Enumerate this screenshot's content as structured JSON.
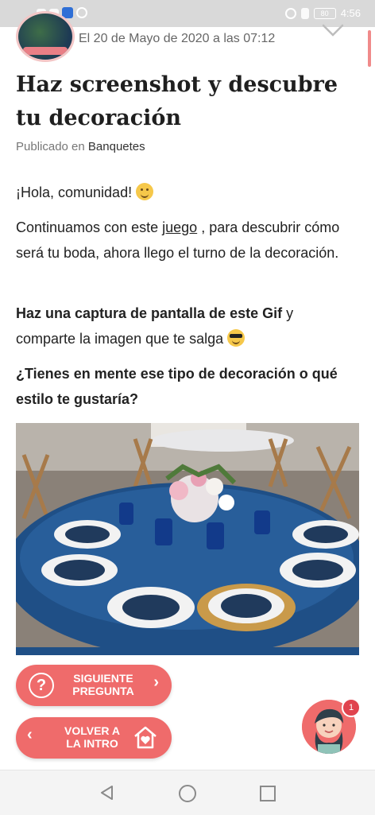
{
  "status_bar": {
    "time": "4:56",
    "battery": "80",
    "icons": [
      "signal-icon",
      "wifi-icon",
      "vpn-shield-icon",
      "whatsapp-icon",
      "alarm-icon",
      "vibrate-icon",
      "battery-icon"
    ]
  },
  "post": {
    "date": "El 20 de Mayo de 2020 a las 07:12",
    "title": "Haz screenshot y descubre tu decoración",
    "published_prefix": "Publicado en",
    "category": "Banquetes",
    "greeting": "¡Hola, comunidad!",
    "p2_before": "Continuamos con este",
    "p2_link": "juego",
    "p2_after": ", para descubrir cómo será tu boda, ahora llego el turno de la decoración.",
    "p3_bold": "Haz una captura de pantalla de este Gif",
    "p3_rest": " y comparte la imagen que te salga",
    "question": "¿Tienes en mente ese tipo de decoración o qué estilo te gustaría?",
    "image_alt_icon": "wedding-table-photo"
  },
  "buttons": {
    "next_line1": "SIGUIENTE",
    "next_line2": "PREGUNTA",
    "next_icon": "question-icon",
    "back_line1": "VOLVER A",
    "back_line2": "LA INTRO",
    "back_icon": "home-heart-icon"
  },
  "chat": {
    "badge_count": "1",
    "icon": "mascot-avatar-icon"
  },
  "colors": {
    "accent": "#ef6b6b",
    "badge": "#e0434e",
    "tablecloth": "#1f4f86"
  }
}
